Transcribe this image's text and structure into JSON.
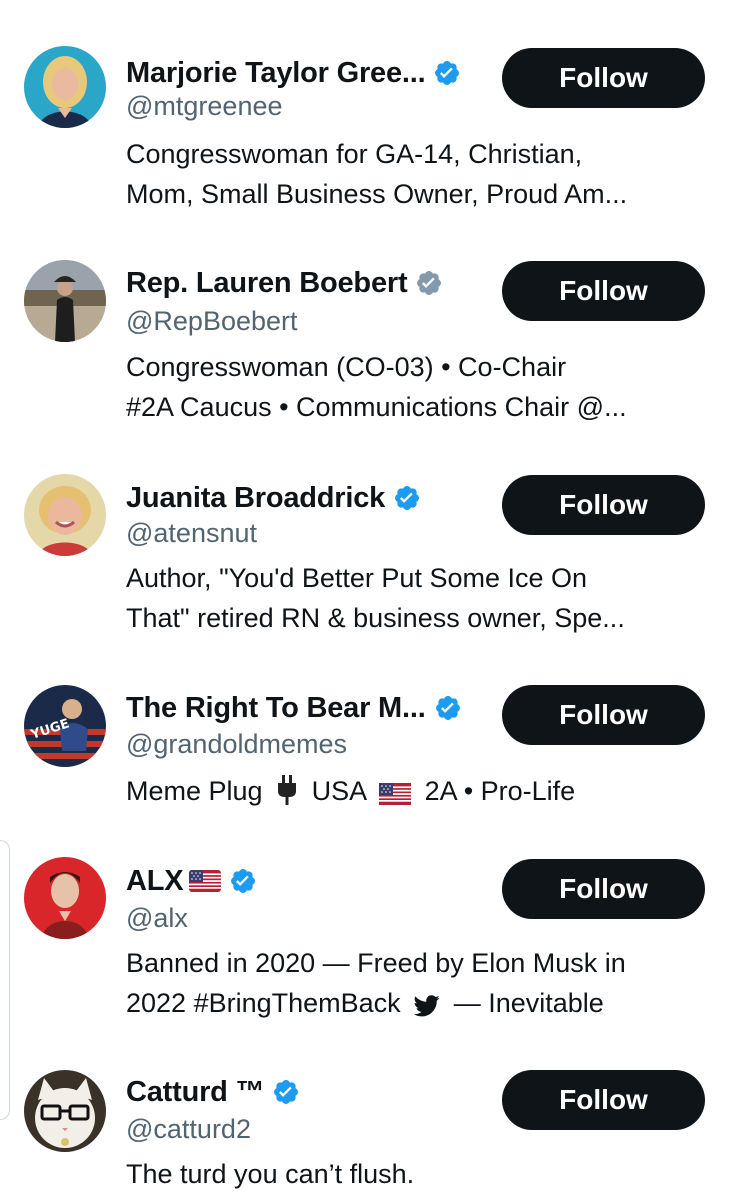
{
  "accounts": [
    {
      "name": "Marjorie Taylor Gree...",
      "handle": "@mtgreenee",
      "verified": "blue",
      "bio_lines": [
        "Congresswoman for GA-14, Christian,",
        "Mom, Small Business Owner, Proud Am..."
      ],
      "button": "Follow",
      "avatar": "woman-blonde-portrait"
    },
    {
      "name": "Rep. Lauren Boebert",
      "handle": "@RepBoebert",
      "verified": "gray",
      "bio_lines": [
        "Congresswoman (CO-03) • Co-Chair",
        "#2A Caucus • Communications Chair @..."
      ],
      "button": "Follow",
      "avatar": "woman-outdoors-portrait"
    },
    {
      "name": "Juanita Broaddrick",
      "handle": "@atensnut",
      "verified": "blue",
      "bio_lines": [
        "Author, \"You'd Better Put Some Ice On",
        "That\" retired RN & business owner, Spe..."
      ],
      "button": "Follow",
      "avatar": "woman-smiling-portrait"
    },
    {
      "name": "The Right To Bear M...",
      "handle": "@grandoldmemes",
      "verified": "blue",
      "bio": {
        "part1": "Meme Plug",
        "icon1": "plug-icon",
        "part2": "USA",
        "icon2": "us-flag-icon",
        "part3": "2A • Pro-Life"
      },
      "button": "Follow",
      "avatar": "yuge-meme-avatar",
      "avatar_text": "YUGE"
    },
    {
      "name": "ALX",
      "name_flag": "us-flag-icon",
      "handle": "@alx",
      "verified": "blue",
      "bio_lines": [
        "Banned in 2020 — Freed by Elon Musk in"
      ],
      "bio_line2": {
        "part1": "2022 #BringThemBack",
        "icon": "twitter-bird-icon",
        "part2": "— Inevitable"
      },
      "button": "Follow",
      "avatar": "man-red-background-portrait"
    },
    {
      "name": "Catturd ™",
      "handle": "@catturd2",
      "verified": "blue",
      "bio_lines": [
        "The turd you can’t flush."
      ],
      "button": "Follow",
      "avatar": "cat-with-glasses-avatar"
    }
  ],
  "colors": {
    "verified_blue": "#1d9bf0",
    "verified_gray": "#829aab",
    "button_bg": "#0f1419",
    "handle_text": "#536471"
  }
}
